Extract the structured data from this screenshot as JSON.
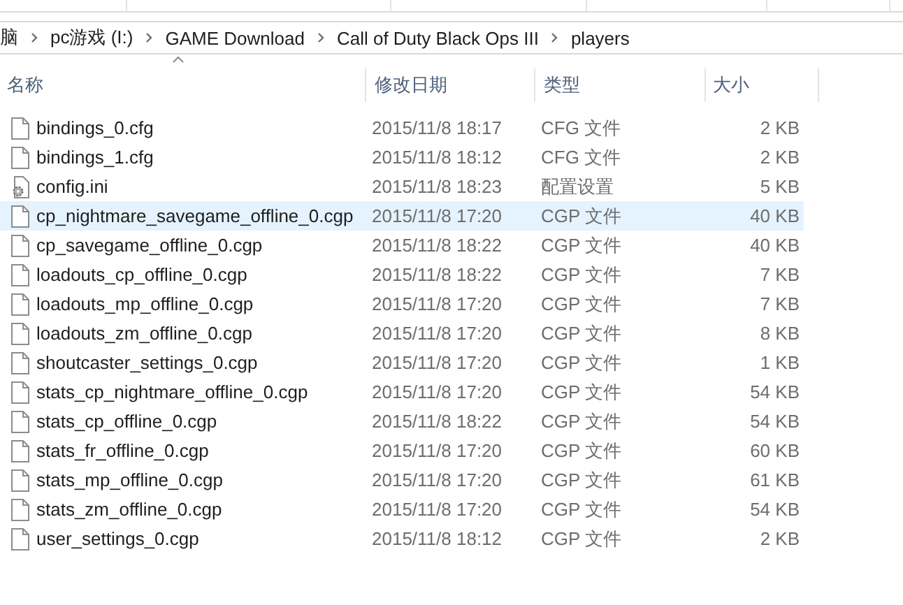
{
  "address_bar": {
    "path": [
      "脑",
      "pc游戏 (I:)",
      "GAME Download",
      "Call of Duty Black Ops III",
      "players"
    ]
  },
  "columns": [
    {
      "label": "名称",
      "sorted": true
    },
    {
      "label": "修改日期",
      "sorted": false
    },
    {
      "label": "类型",
      "sorted": false
    },
    {
      "label": "大小",
      "sorted": false
    }
  ],
  "files": [
    {
      "name": "bindings_0.cfg",
      "modified": "2015/11/8 18:17",
      "type": "CFG 文件",
      "size": "2 KB",
      "kind": "file",
      "selected": false
    },
    {
      "name": "bindings_1.cfg",
      "modified": "2015/11/8 18:12",
      "type": "CFG 文件",
      "size": "2 KB",
      "kind": "file",
      "selected": false
    },
    {
      "name": "config.ini",
      "modified": "2015/11/8 18:23",
      "type": "配置设置",
      "size": "5 KB",
      "kind": "settings",
      "selected": false
    },
    {
      "name": "cp_nightmare_savegame_offline_0.cgp",
      "modified": "2015/11/8 17:20",
      "type": "CGP 文件",
      "size": "40 KB",
      "kind": "file",
      "selected": true
    },
    {
      "name": "cp_savegame_offline_0.cgp",
      "modified": "2015/11/8 18:22",
      "type": "CGP 文件",
      "size": "40 KB",
      "kind": "file",
      "selected": false
    },
    {
      "name": "loadouts_cp_offline_0.cgp",
      "modified": "2015/11/8 18:22",
      "type": "CGP 文件",
      "size": "7 KB",
      "kind": "file",
      "selected": false
    },
    {
      "name": "loadouts_mp_offline_0.cgp",
      "modified": "2015/11/8 17:20",
      "type": "CGP 文件",
      "size": "7 KB",
      "kind": "file",
      "selected": false
    },
    {
      "name": "loadouts_zm_offline_0.cgp",
      "modified": "2015/11/8 17:20",
      "type": "CGP 文件",
      "size": "8 KB",
      "kind": "file",
      "selected": false
    },
    {
      "name": "shoutcaster_settings_0.cgp",
      "modified": "2015/11/8 17:20",
      "type": "CGP 文件",
      "size": "1 KB",
      "kind": "file",
      "selected": false
    },
    {
      "name": "stats_cp_nightmare_offline_0.cgp",
      "modified": "2015/11/8 17:20",
      "type": "CGP 文件",
      "size": "54 KB",
      "kind": "file",
      "selected": false
    },
    {
      "name": "stats_cp_offline_0.cgp",
      "modified": "2015/11/8 18:22",
      "type": "CGP 文件",
      "size": "54 KB",
      "kind": "file",
      "selected": false
    },
    {
      "name": "stats_fr_offline_0.cgp",
      "modified": "2015/11/8 17:20",
      "type": "CGP 文件",
      "size": "60 KB",
      "kind": "file",
      "selected": false
    },
    {
      "name": "stats_mp_offline_0.cgp",
      "modified": "2015/11/8 17:20",
      "type": "CGP 文件",
      "size": "61 KB",
      "kind": "file",
      "selected": false
    },
    {
      "name": "stats_zm_offline_0.cgp",
      "modified": "2015/11/8 17:20",
      "type": "CGP 文件",
      "size": "54 KB",
      "kind": "file",
      "selected": false
    },
    {
      "name": "user_settings_0.cgp",
      "modified": "2015/11/8 18:12",
      "type": "CGP 文件",
      "size": "2 KB",
      "kind": "file",
      "selected": false
    }
  ]
}
